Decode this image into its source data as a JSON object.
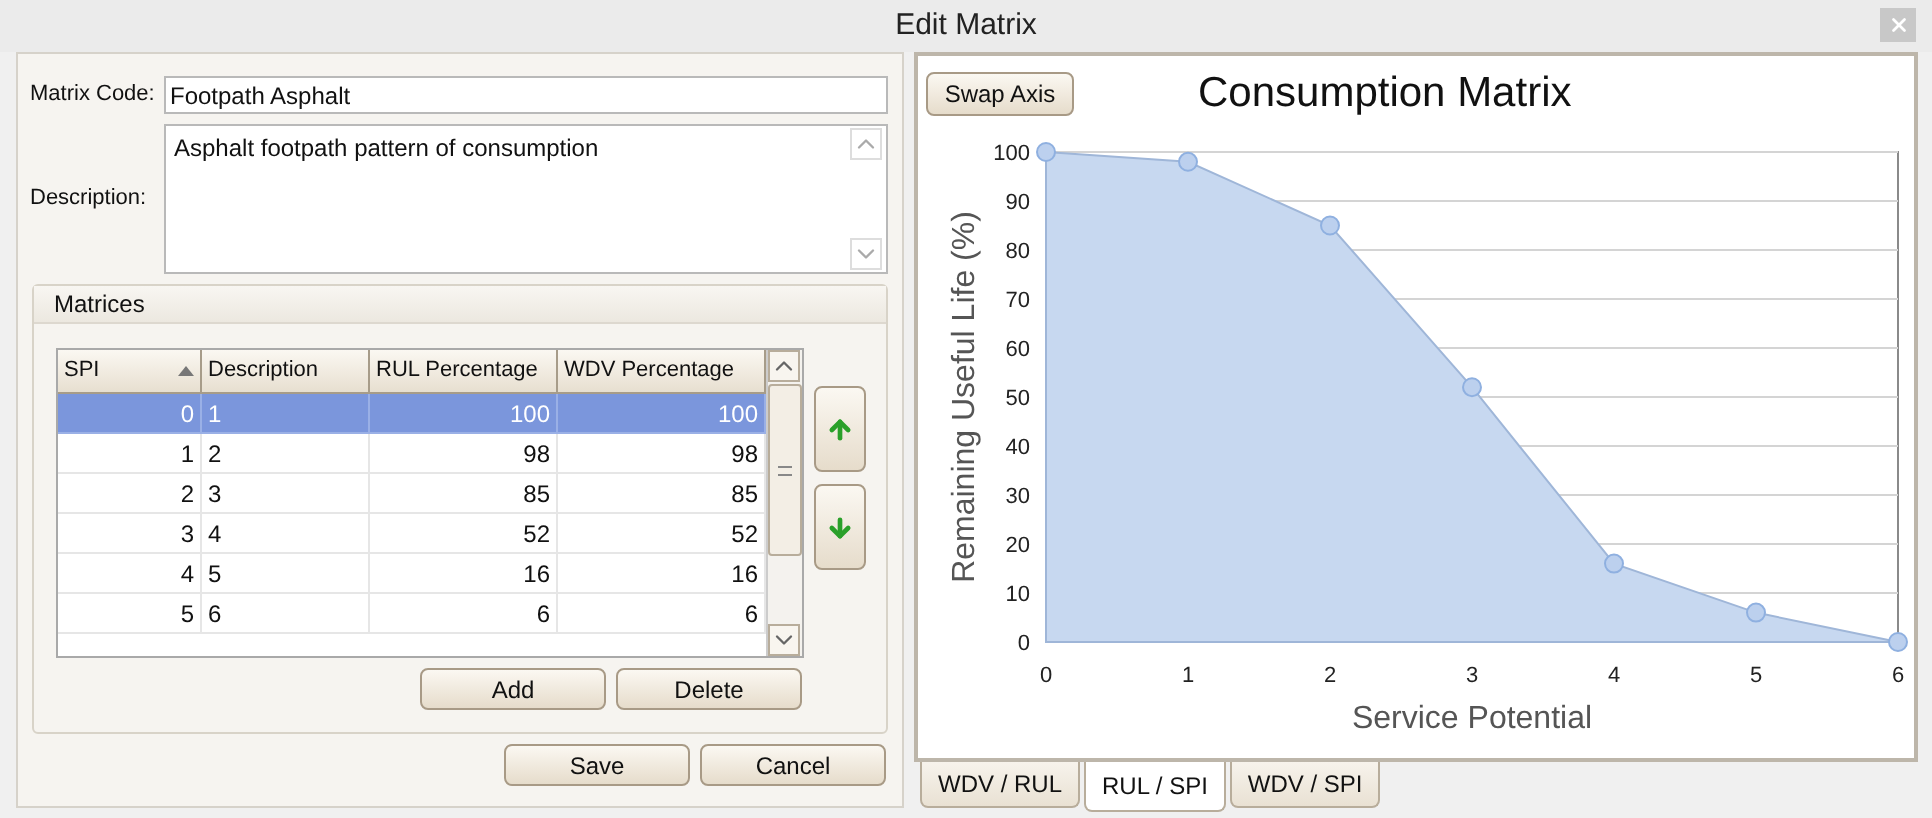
{
  "window": {
    "title": "Edit Matrix"
  },
  "form": {
    "matrix_code": {
      "label": "Matrix Code:",
      "value": "Footpath Asphalt"
    },
    "description": {
      "label": "Description:",
      "value": "Asphalt footpath pattern of consumption"
    }
  },
  "matrices": {
    "title": "Matrices",
    "columns": [
      "SPI",
      "Description",
      "RUL Percentage",
      "WDV Percentage"
    ],
    "rows": [
      {
        "cells": [
          "0",
          "1",
          "100",
          "100"
        ],
        "selected": true
      },
      {
        "cells": [
          "1",
          "2",
          "98",
          "98"
        ],
        "selected": false
      },
      {
        "cells": [
          "2",
          "3",
          "85",
          "85"
        ],
        "selected": false
      },
      {
        "cells": [
          "3",
          "4",
          "52",
          "52"
        ],
        "selected": false
      },
      {
        "cells": [
          "4",
          "5",
          "16",
          "16"
        ],
        "selected": false
      },
      {
        "cells": [
          "5",
          "6",
          "6",
          "6"
        ],
        "selected": false
      }
    ],
    "buttons": [
      "Add",
      "Delete"
    ]
  },
  "buttons": [
    "Save",
    "Cancel"
  ],
  "chart_panel": {
    "swap_button": "Swap Axis",
    "chart_data": {
      "type": "area",
      "title": "Consumption Matrix",
      "xlabel": "Service Potential",
      "ylabel": "Remaining Useful Life (%)",
      "x": [
        0,
        1,
        2,
        3,
        4,
        5,
        6
      ],
      "series": [
        {
          "color": "#c7d8f0",
          "values": [
            100,
            98,
            85,
            52,
            16,
            6,
            0
          ]
        }
      ],
      "grid": true,
      "xlim": [
        0,
        6
      ],
      "ylim": [
        0,
        100
      ],
      "xticks": [
        0,
        1,
        2,
        3,
        4,
        5,
        6
      ],
      "yticks": [
        0,
        10,
        20,
        30,
        40,
        50,
        60,
        70,
        80,
        90,
        100
      ]
    },
    "tabs": [
      {
        "label": "WDV / RUL",
        "selected": false
      },
      {
        "label": "RUL / SPI",
        "selected": true
      },
      {
        "label": "WDV / SPI",
        "selected": false
      }
    ]
  }
}
